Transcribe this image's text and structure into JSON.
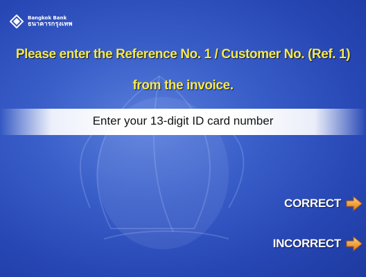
{
  "brand": {
    "name_en": "Bangkok Bank",
    "name_th": "ธนาคารกรุงเทพ",
    "icon": "bangkok-bank-logo-icon"
  },
  "prompt": {
    "line1": "Please enter the Reference No. 1 / Customer No. (Ref. 1)",
    "line2": "from the invoice."
  },
  "input": {
    "text": "Enter your 13-digit ID card number"
  },
  "options": {
    "correct": {
      "label": "CORRECT",
      "icon": "arrow-right-icon"
    },
    "incorrect": {
      "label": "INCORRECT",
      "icon": "arrow-right-icon"
    }
  },
  "colors": {
    "background": "#2f52c0",
    "prompt_text": "#f5e94a",
    "option_text": "#ffffff",
    "arrow": "#f0a030"
  }
}
